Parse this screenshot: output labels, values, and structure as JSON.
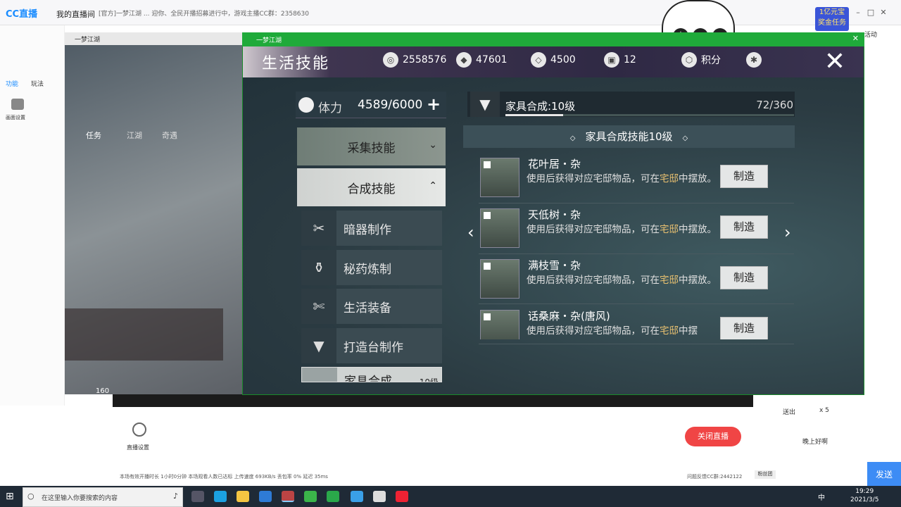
{
  "cc": {
    "logo": "CC直播",
    "menu_my_stream": "我的直播间",
    "announce": "[官方]一梦江湖 ... 迎你、全民开播招募进行中，游戏主播CC群：2358630",
    "tab_function": "功能",
    "tab_play": "玩法",
    "left_item": "画面设置",
    "stream_settings": "直播设置",
    "stop_live": "关闭直播",
    "send": "发送",
    "fans": "粉丝团",
    "gift_label": "送出",
    "gift_count": "x 5",
    "chat_line": "晚上好啊",
    "status_bar": "本场有效开播时长 1小时0分钟   本场观看人数已达标     上传速度 693KB/s   丢包率 0%   延迟 35ms",
    "feedback": "问题反馈CC群:2442122",
    "badge": "1亿元宝 奖金任务",
    "right_tab": "活动"
  },
  "taskbar": {
    "search_placeholder": "在这里输入你要搜索的内容",
    "time": "19:29",
    "date": "2021/3/5",
    "ime": "中"
  },
  "bg_game": {
    "title": "一梦江湖",
    "tab_task": "任务",
    "tab_jianghu": "江湖",
    "tab_qiyu": "奇遇",
    "level": "160"
  },
  "game": {
    "window_title": "一梦江湖",
    "title": "生活技能",
    "currencies": [
      {
        "icon": "silver-coin-icon",
        "value": "2558576"
      },
      {
        "icon": "ingot-icon",
        "value": "47601"
      },
      {
        "icon": "jade-icon",
        "value": "4500"
      },
      {
        "icon": "token-icon",
        "value": "12"
      }
    ],
    "points_label": "积分",
    "stamina": {
      "label": "体力",
      "value": "4589/6000",
      "plus": "+"
    },
    "categories": [
      {
        "label": "采集技能",
        "arrow": "⌄"
      },
      {
        "label": "合成技能",
        "arrow": "⌃"
      }
    ],
    "sub_skills": [
      {
        "icon": "dart-icon",
        "label": "暗器制作"
      },
      {
        "icon": "potion-icon",
        "label": "秘药炼制"
      },
      {
        "icon": "scissors-icon",
        "label": "生活装备"
      },
      {
        "icon": "anvil-icon",
        "label": "打造台制作"
      },
      {
        "icon": "furniture-icon",
        "label": "家具合成",
        "level": "10级"
      }
    ],
    "skill": {
      "name": "家具合成:10级",
      "xp": "72/360",
      "xp_fraction": 0.2,
      "banner": "家具合成技能10级"
    },
    "items": [
      {
        "name": "花叶居・杂",
        "desc_a": "使用后获得对应宅邸物品，可在",
        "desc_hl": "宅邸",
        "desc_b": "中摆放。",
        "button": "制造"
      },
      {
        "name": "天低树・杂",
        "desc_a": "使用后获得对应宅邸物品，可在",
        "desc_hl": "宅邸",
        "desc_b": "中摆放。",
        "button": "制造"
      },
      {
        "name": "满枝雪・杂",
        "desc_a": "使用后获得对应宅邸物品，可在",
        "desc_hl": "宅邸",
        "desc_b": "中摆放。",
        "button": "制造"
      },
      {
        "name": "话桑麻・杂(唐风)",
        "desc_a": "使用后获得对应宅邸物品，可在",
        "desc_hl": "宅邸",
        "desc_b": "中摆",
        "button": "制造"
      }
    ],
    "prev": "‹",
    "next": "›",
    "close": "✕"
  },
  "colors": {
    "game_border": "#1faa3a",
    "highlight": "#e8c070",
    "stop_live": "#f04545",
    "send": "#3d8cf5"
  }
}
